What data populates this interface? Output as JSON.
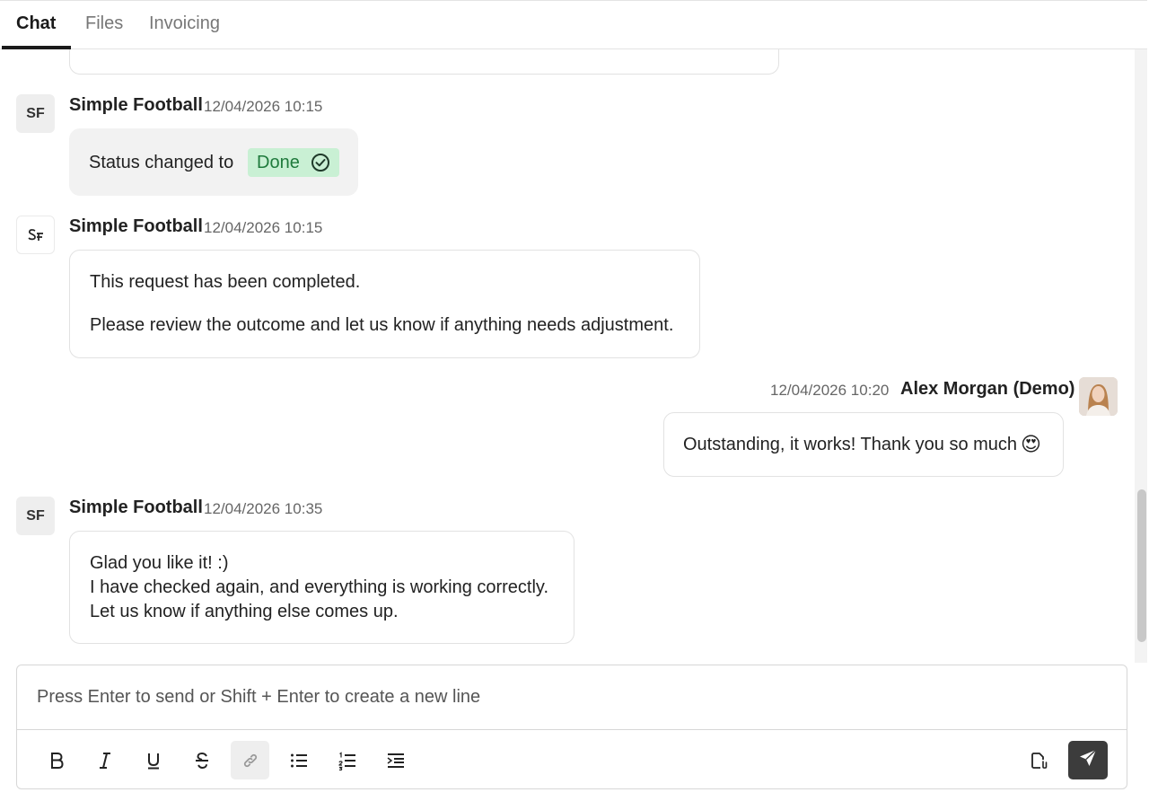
{
  "tabs": [
    {
      "label": "Chat",
      "active": true
    },
    {
      "label": "Files",
      "active": false
    },
    {
      "label": "Invoicing",
      "active": false
    }
  ],
  "messages": [
    {
      "sender": "Simple Football",
      "avatar": "SF",
      "time": "12/04/2026 10:15",
      "status_prefix": "Status changed to",
      "status_value": "Done"
    },
    {
      "sender": "Simple Football",
      "avatar_icon": "simple-football-logo-icon",
      "time": "12/04/2026 10:15",
      "lines": [
        "This request has been completed.",
        "Please review the outcome and let us know if anything needs adjustment."
      ]
    },
    {
      "sender": "Alex Morgan (Demo)",
      "time": "12/04/2026 10:20",
      "text": "Outstanding, it works! Thank you so much",
      "emoji": "😍"
    },
    {
      "sender": "Simple Football",
      "avatar": "SF",
      "time": "12/04/2026 10:35",
      "lines": [
        "Glad you like it! :)",
        "I have checked again, and everything is working correctly.",
        "Let us know if anything else comes up."
      ]
    }
  ],
  "composer": {
    "placeholder": "Press Enter to send or Shift + Enter to create a new line",
    "tools": [
      "bold-icon",
      "italic-icon",
      "underline-icon",
      "strikethrough-icon",
      "link-icon",
      "bullet-list-icon",
      "numbered-list-icon",
      "indent-icon"
    ],
    "attach_icon": "attach-file-icon",
    "send_icon": "send-icon"
  },
  "colors": {
    "status_bg": "#c9f0d4",
    "status_text": "#1f7a3c",
    "send_bg": "#3c3c3c"
  }
}
